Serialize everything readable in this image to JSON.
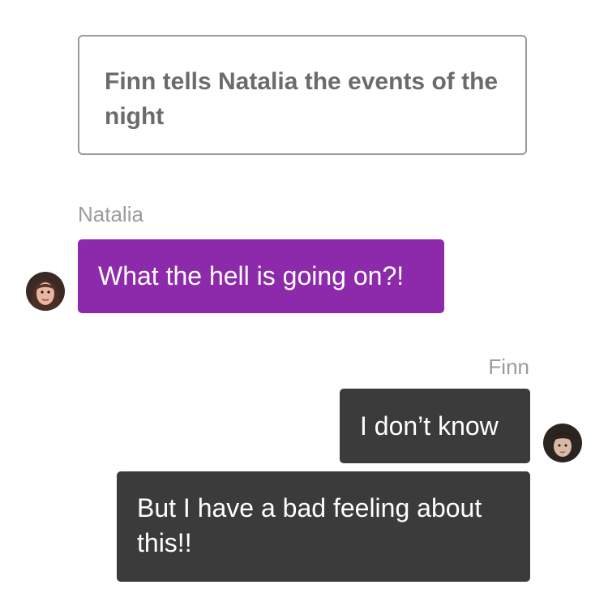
{
  "narration": {
    "text": "Finn tells Natalia the events of the night"
  },
  "messages": [
    {
      "sender": "Natalia",
      "text": "What the hell is going on?!",
      "side": "left",
      "bubble_color": "#8d2aab",
      "avatar": "natalia-avatar"
    },
    {
      "sender": "Finn",
      "text": "I don’t know",
      "side": "right",
      "bubble_color": "#3b3b3b",
      "avatar": "finn-avatar"
    },
    {
      "sender": "Finn",
      "text": "But I have a bad feeling about this!!",
      "side": "right",
      "bubble_color": "#3b3b3b"
    }
  ],
  "colors": {
    "natalia_bubble": "#8d2aab",
    "finn_bubble": "#3b3b3b",
    "sender_label": "#9b9b9b",
    "narration_text": "#6b6b6b",
    "narration_border": "#9a9a9a"
  }
}
